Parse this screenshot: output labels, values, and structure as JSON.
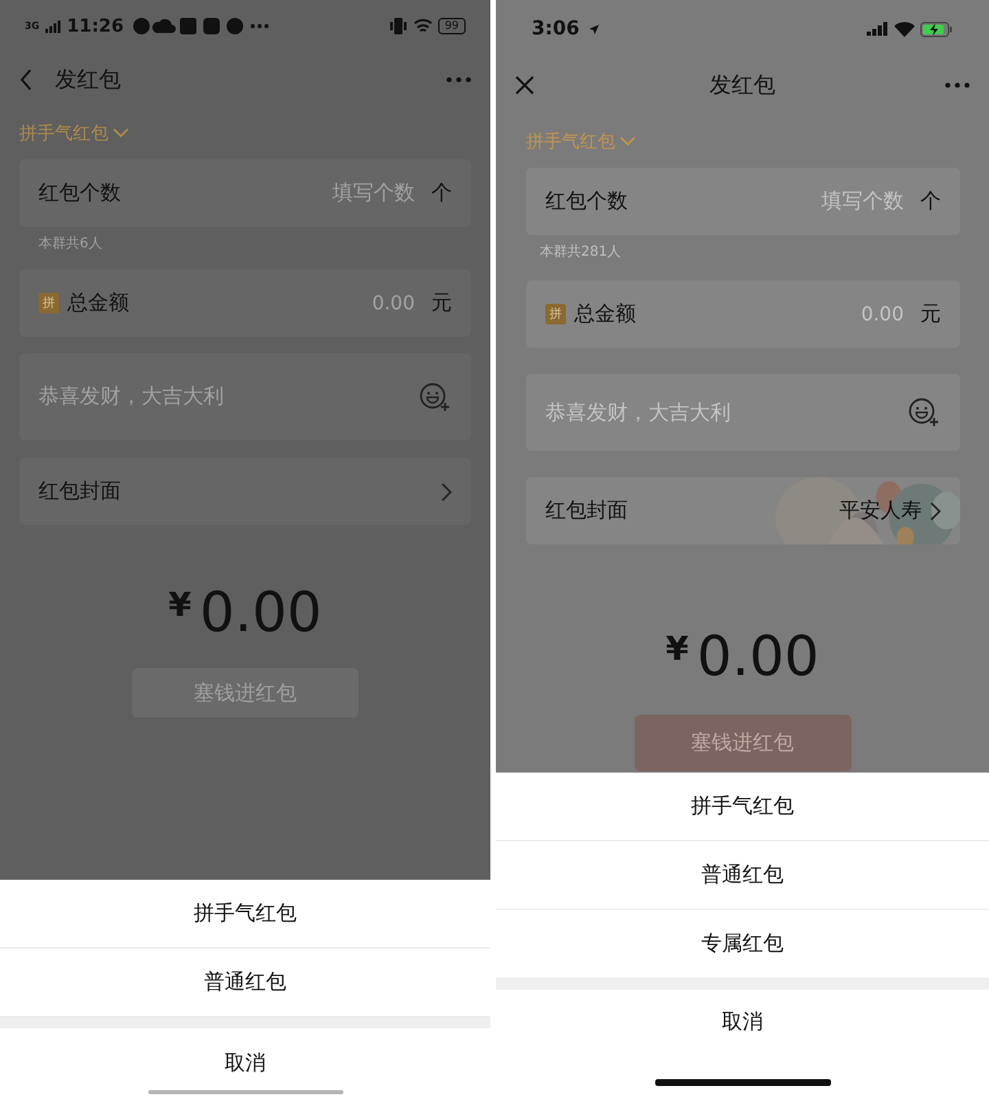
{
  "screens": [
    {
      "kind": "android",
      "status_bar": {
        "network": "3G",
        "time": "11:26",
        "battery": "99"
      },
      "nav": {
        "title": "发红包"
      },
      "mode": "拼手气红包",
      "count_field": {
        "label": "红包个数",
        "placeholder": "填写个数",
        "unit": "个"
      },
      "group_note": "本群共6人",
      "amount_field": {
        "badge": "拼",
        "label": "总金额",
        "placeholder": "0.00",
        "unit": "元"
      },
      "greeting_field": {
        "placeholder": "恭喜发财，大吉大利"
      },
      "cover_row": {
        "label": "红包封面"
      },
      "currency": "¥",
      "total": "0.00",
      "submit_button": "塞钱进红包",
      "sheet": {
        "options": [
          "拼手气红包",
          "普通红包"
        ],
        "cancel": "取消"
      }
    },
    {
      "kind": "ios",
      "status_bar": {
        "time": "3:06"
      },
      "nav": {
        "title": "发红包"
      },
      "mode": "拼手气红包",
      "count_field": {
        "label": "红包个数",
        "placeholder": "填写个数",
        "unit": "个"
      },
      "group_note": "本群共281人",
      "amount_field": {
        "badge": "拼",
        "label": "总金额",
        "placeholder": "0.00",
        "unit": "元"
      },
      "greeting_field": {
        "placeholder": "恭喜发财，大吉大利"
      },
      "cover_row": {
        "label": "红包封面",
        "value": "平安人寿",
        "picture": true
      },
      "currency": "¥",
      "total": "0.00",
      "submit_button": "塞钱进红包",
      "sheet": {
        "options": [
          "拼手气红包",
          "普通红包",
          "专属红包"
        ],
        "cancel": "取消"
      }
    }
  ]
}
